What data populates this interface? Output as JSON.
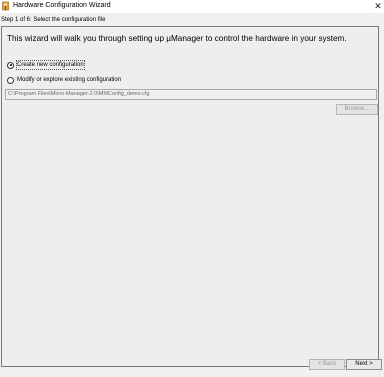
{
  "window": {
    "title": "Hardware Configuration Wizard",
    "close_symbol": "✕"
  },
  "wizard": {
    "step_label": "Step 1 of 6: Select the configuration file",
    "intro": "This wizard will walk you through setting up µManager to control the hardware in your system.",
    "options": [
      {
        "label": "Create new configuration",
        "selected": true
      },
      {
        "label": "Modify or explore existing configuration",
        "selected": false
      }
    ],
    "config_path": "C:\\Program Files\\Micro-Manager-2.0\\MMConfig_demo.cfg",
    "browse_label": "Browse...",
    "back_label": "< Back",
    "next_label": "Next >"
  },
  "colors": {
    "window_bg": "#f0f0f0",
    "panel_border": "#7a7a7a",
    "icon_orange": "#e8a33a"
  },
  "icons": {
    "app": "micro-manager-icon",
    "close": "close-icon"
  }
}
